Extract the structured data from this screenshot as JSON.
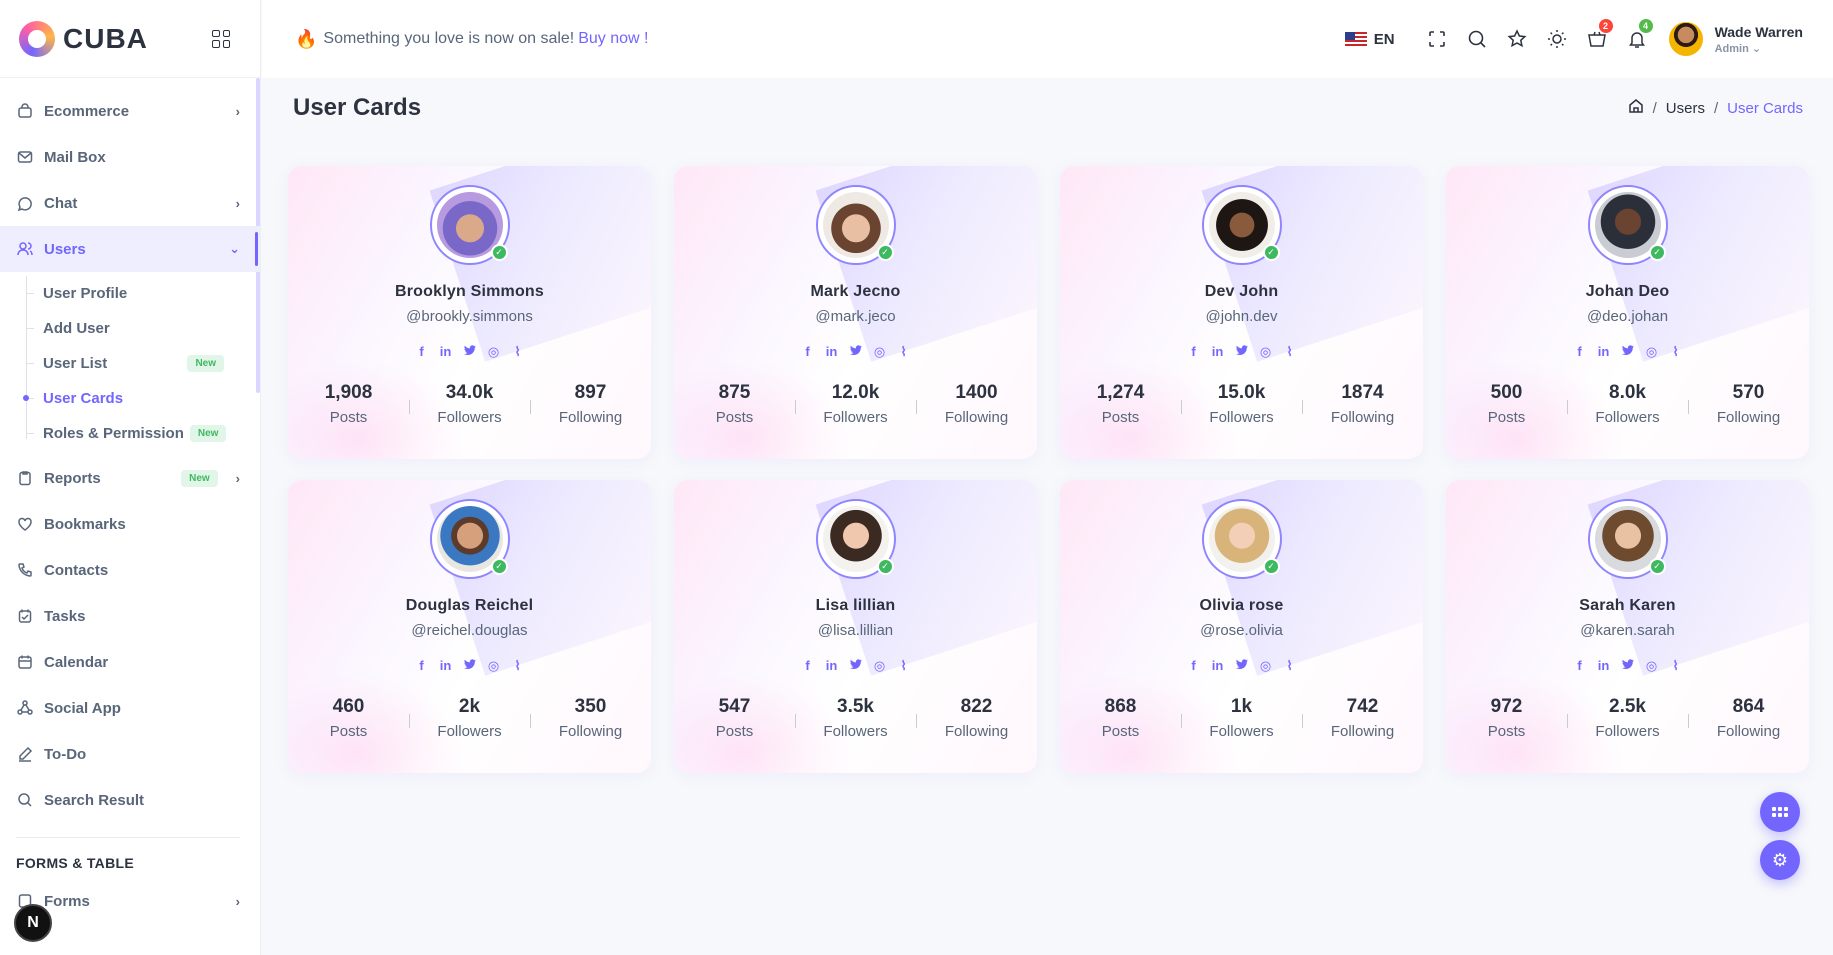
{
  "brand": {
    "name": "CUBA"
  },
  "header": {
    "promo_text": "Something you love is now on sale!",
    "promo_link": "Buy now !",
    "language": "EN",
    "cart_count": "2",
    "notification_count": "4",
    "user_name": "Wade Warren",
    "user_role": "Admin"
  },
  "sidebar": {
    "items": [
      {
        "label": "Ecommerce"
      },
      {
        "label": "Mail Box"
      },
      {
        "label": "Chat"
      },
      {
        "label": "Users"
      },
      {
        "label": "Reports",
        "badge": "New"
      },
      {
        "label": "Bookmarks"
      },
      {
        "label": "Contacts"
      },
      {
        "label": "Tasks"
      },
      {
        "label": "Calendar"
      },
      {
        "label": "Social App"
      },
      {
        "label": "To-Do"
      },
      {
        "label": "Search Result"
      }
    ],
    "users_sub": [
      {
        "label": "User Profile"
      },
      {
        "label": "Add User"
      },
      {
        "label": "User List",
        "badge": "New"
      },
      {
        "label": "User Cards"
      },
      {
        "label": "Roles & Permission",
        "badge": "New"
      }
    ],
    "section_title": "FORMS & TABLE",
    "section_items": [
      {
        "label": "Forms"
      }
    ],
    "corner_badge": "N"
  },
  "page": {
    "title": "User Cards",
    "breadcrumb": [
      "Users",
      "User Cards"
    ]
  },
  "labels": {
    "posts": "Posts",
    "followers": "Followers",
    "following": "Following"
  },
  "cards": [
    {
      "name": "Brooklyn Simmons",
      "handle": "@brookly.simmons",
      "posts": "1,908",
      "followers": "34.0k",
      "following": "897"
    },
    {
      "name": "Mark Jecno",
      "handle": "@mark.jeco",
      "posts": "875",
      "followers": "12.0k",
      "following": "1400"
    },
    {
      "name": "Dev John",
      "handle": "@john.dev",
      "posts": "1,274",
      "followers": "15.0k",
      "following": "1874"
    },
    {
      "name": "Johan Deo",
      "handle": "@deo.johan",
      "posts": "500",
      "followers": "8.0k",
      "following": "570"
    },
    {
      "name": "Douglas Reichel",
      "handle": "@reichel.douglas",
      "posts": "460",
      "followers": "2k",
      "following": "350"
    },
    {
      "name": "Lisa lillian",
      "handle": "@lisa.lillian",
      "posts": "547",
      "followers": "3.5k",
      "following": "822"
    },
    {
      "name": "Olivia rose",
      "handle": "@rose.olivia",
      "posts": "868",
      "followers": "1k",
      "following": "742"
    },
    {
      "name": "Sarah Karen",
      "handle": "@karen.sarah",
      "posts": "972",
      "followers": "2.5k",
      "following": "864"
    }
  ],
  "colors": {
    "accent": "#7366ff",
    "online": "#3eb95f",
    "new_badge": "#3eb95f",
    "badge_red": "#fc4438",
    "badge_green": "#54ba4a"
  }
}
